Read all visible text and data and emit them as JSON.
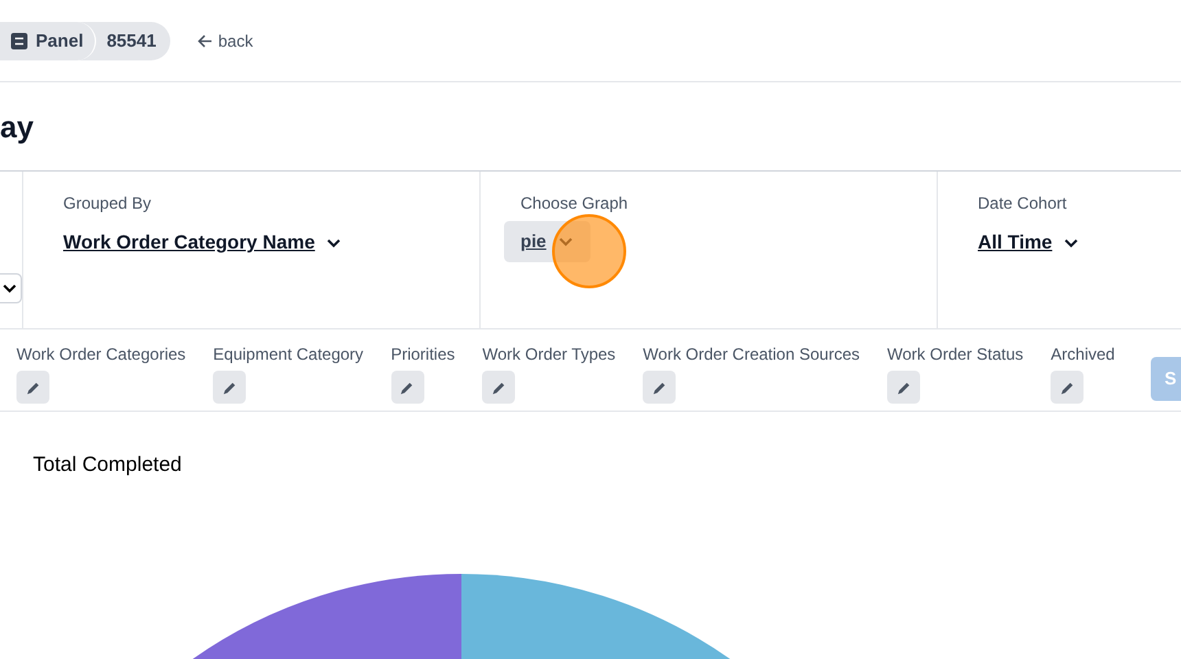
{
  "breadcrumb": {
    "items": [
      {
        "label": "Panel",
        "kind": "icon"
      },
      {
        "label": "85541",
        "kind": "plain"
      }
    ],
    "back": "back"
  },
  "title": "ay",
  "filters": [
    {
      "label": "Grouped By",
      "value": "Work Order Category Name",
      "kind": "link"
    },
    {
      "label": "Choose Graph",
      "value": "pie",
      "kind": "pill"
    },
    {
      "label": "Date Cohort",
      "value": "All Time",
      "kind": "link"
    }
  ],
  "edit_filters": [
    {
      "label": "Work Order Categories"
    },
    {
      "label": "Equipment Category"
    },
    {
      "label": "Priorities"
    },
    {
      "label": "Work Order Types"
    },
    {
      "label": "Work Order Creation Sources"
    },
    {
      "label": "Work Order Status"
    },
    {
      "label": "Archived"
    }
  ],
  "save_button": "S",
  "chart": {
    "title": "Total Completed"
  }
}
